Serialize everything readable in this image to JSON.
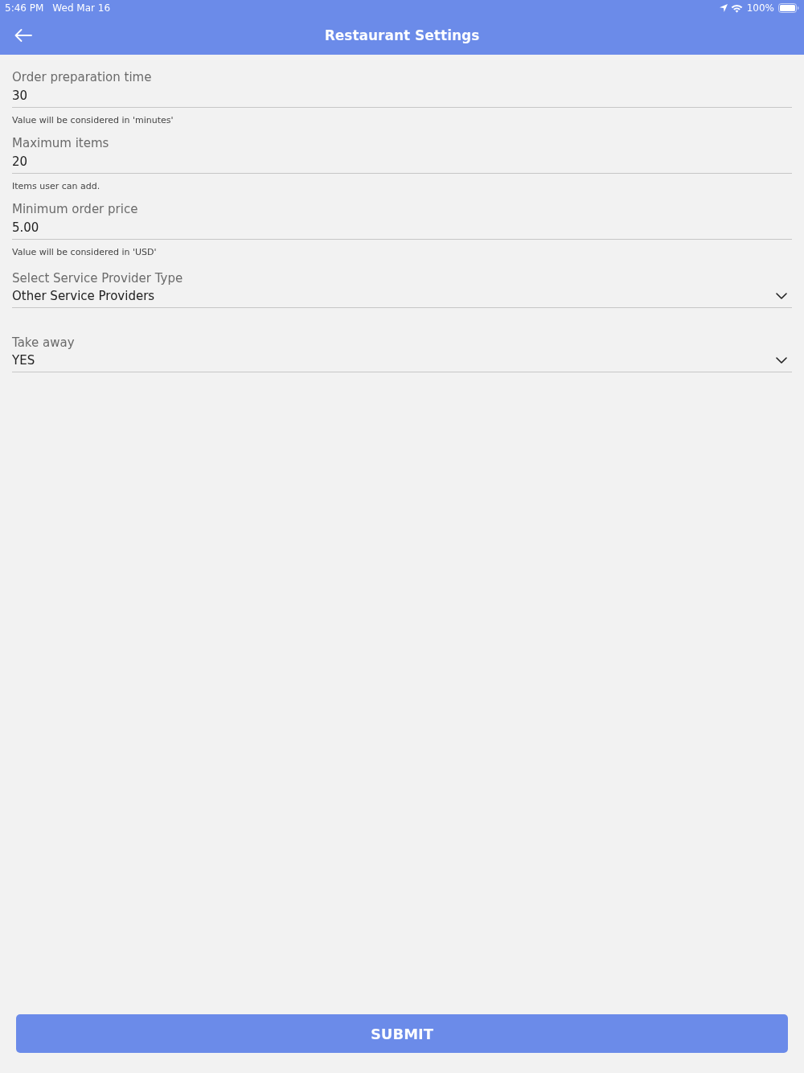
{
  "status_bar": {
    "time": "5:46 PM",
    "date": "Wed Mar 16",
    "battery": "100%"
  },
  "header": {
    "title": "Restaurant Settings"
  },
  "fields": [
    {
      "kind": "input",
      "label": "Order preparation time",
      "value": "30",
      "hint": "Value will be considered in 'minutes'"
    },
    {
      "kind": "input",
      "label": "Maximum items",
      "value": "20",
      "hint": "Items user can add."
    },
    {
      "kind": "input",
      "label": "Minimum order price",
      "value": "5.00",
      "hint": "Value will be considered in 'USD'"
    },
    {
      "kind": "select",
      "label": "Select Service Provider Type",
      "value": "Other Service Providers"
    },
    {
      "kind": "select",
      "label": "Take away",
      "value": "YES"
    }
  ],
  "submit_button": {
    "label": "SUBMIT"
  }
}
